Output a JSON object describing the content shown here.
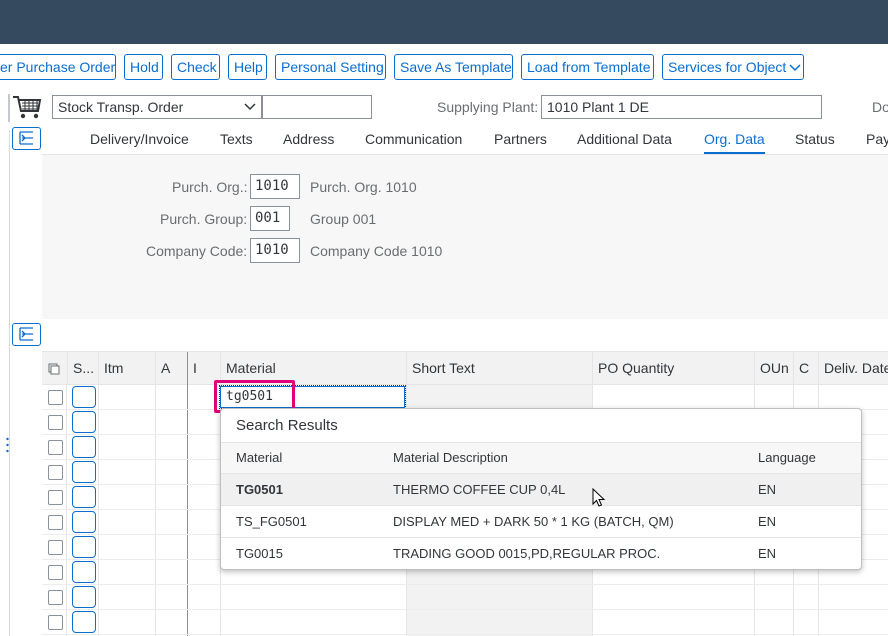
{
  "toolbar": {
    "buttons": [
      "er Purchase Order",
      "Hold",
      "Check",
      "Help",
      "Personal Setting",
      "Save As Template",
      "Load from Template",
      "Services for Object"
    ]
  },
  "header": {
    "doc_type": "Stock Transp. Order",
    "doc_number": "",
    "supplying_plant_label": "Supplying Plant:",
    "supplying_plant_value": "1010 Plant 1 DE",
    "cut_label": "Do"
  },
  "tabs": [
    "Delivery/Invoice",
    "Texts",
    "Address",
    "Communication",
    "Partners",
    "Additional Data",
    "Org. Data",
    "Status",
    "Pay"
  ],
  "active_tab": "Org. Data",
  "org_data": {
    "purch_org_label": "Purch. Org.:",
    "purch_org_value": "1010",
    "purch_org_desc": "Purch. Org. 1010",
    "purch_group_label": "Purch. Group:",
    "purch_group_value": "001",
    "purch_group_desc": "Group 001",
    "company_code_label": "Company Code:",
    "company_code_value": "1010",
    "company_code_desc": "Company Code 1010"
  },
  "grid": {
    "columns": [
      "S...",
      "Itm",
      "A",
      "I",
      "Material",
      "Short Text",
      "PO Quantity",
      "OUn",
      "C",
      "Deliv. Date"
    ],
    "material_input_value": "tg0501"
  },
  "search_popup": {
    "title": "Search Results",
    "columns": [
      "Material",
      "Material Description",
      "Language"
    ],
    "rows": [
      {
        "material": "TG0501",
        "description": "THERMO COFFEE CUP 0,4L",
        "language": "EN"
      },
      {
        "material": "TS_FG0501",
        "description": "DISPLAY MED + DARK 50 * 1 KG (BATCH, QM)",
        "language": "EN"
      },
      {
        "material": "TG0015",
        "description": "TRADING GOOD 0015,PD,REGULAR PROC.",
        "language": "EN"
      }
    ]
  },
  "colors": {
    "shell": "#354a5f",
    "accent": "#0a6ed1",
    "highlight": "#e0007a"
  }
}
